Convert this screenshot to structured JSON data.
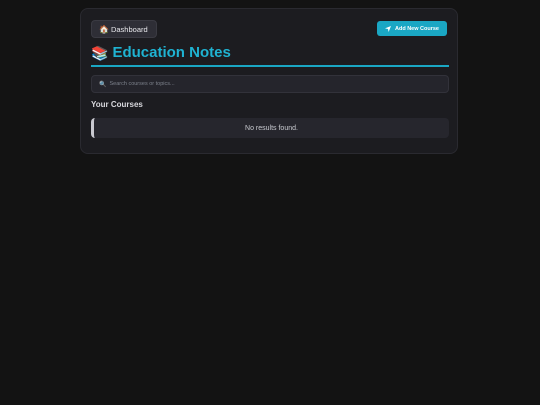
{
  "header": {
    "dashboard_icon": "🏠",
    "dashboard_label": "Dashboard",
    "add_course_label": "Add New Course",
    "add_course_icon": "send-arrow-icon"
  },
  "title": {
    "icon": "📚",
    "text": "Education Notes"
  },
  "search": {
    "icon": "🔍",
    "placeholder": "Search courses or topics...",
    "value": ""
  },
  "courses": {
    "heading": "Your Courses",
    "empty_message": "No results found."
  },
  "colors": {
    "accent": "#1aa7c4",
    "background": "#131313",
    "panel": "#1c1c20"
  }
}
